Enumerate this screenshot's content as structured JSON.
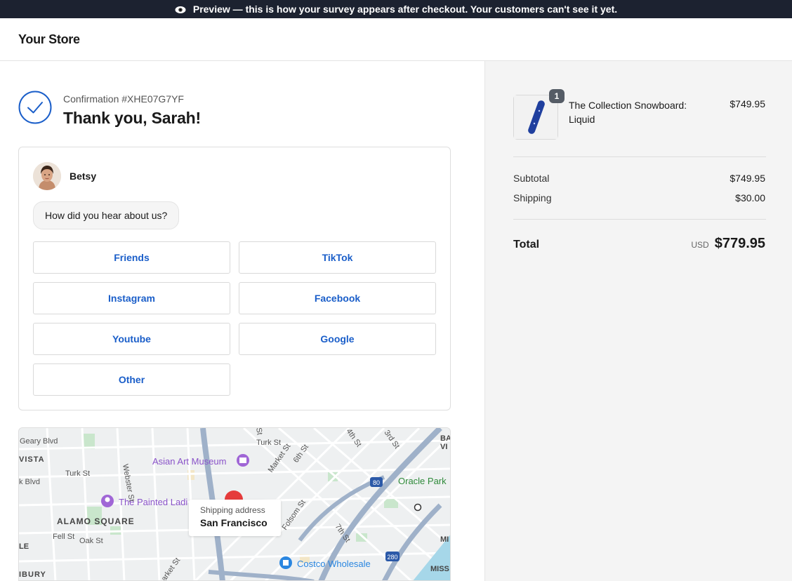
{
  "preview_banner": {
    "icon": "eye-icon",
    "text": "Preview — this is how your survey appears after checkout. Your customers can't see it yet."
  },
  "header": {
    "store_name": "Your Store"
  },
  "confirmation": {
    "number": "Confirmation #XHE07G7YF",
    "thanks": "Thank you, Sarah!",
    "accent": "#1a5ec9"
  },
  "survey": {
    "agent_name": "Betsy",
    "question": "How did you hear about us?",
    "options": [
      "Friends",
      "TikTok",
      "Instagram",
      "Facebook",
      "Youtube",
      "Google",
      "Other"
    ]
  },
  "map": {
    "label_title": "Shipping address",
    "label_city": "San Francisco",
    "places": {
      "asian_art": "Asian Art Museum",
      "painted": "The Painted Ladi",
      "oracle": "Oracle Park",
      "costco": "Costco Wholesale",
      "alamo": "ALAMO SQUARE",
      "vista": "VISTA",
      "geary": "Geary Blvd",
      "turk": "Turk St",
      "turk2": "Turk St",
      "fell": "Fell St",
      "oak": "Oak St",
      "market": "Market St",
      "market2": "arket St",
      "webster": "Webster St",
      "sixth": "6th St",
      "fourth": "4th St",
      "third": "3rd St",
      "seventh": "7th St",
      "folsom": "Folsom St",
      "kblvd": "k Blvd",
      "le": "LE",
      "ibury": "IBURY",
      "ba": "BA",
      "vi": "VI",
      "mi": "MI",
      "miss": "MISS",
      "st": "St",
      "i80": "80",
      "i280": "280"
    }
  },
  "order": {
    "product_title": "The Collection Snowboard: Liquid",
    "product_price": "$749.95",
    "quantity": "1",
    "subtotal_label": "Subtotal",
    "subtotal": "$749.95",
    "shipping_label": "Shipping",
    "shipping": "$30.00",
    "total_label": "Total",
    "currency": "USD",
    "total": "$779.95"
  }
}
